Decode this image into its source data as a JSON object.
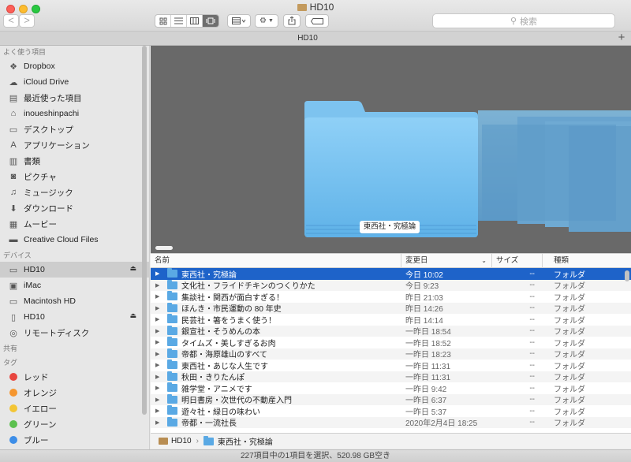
{
  "window": {
    "title": "HD10"
  },
  "toolbar": {
    "back_label": "<",
    "forward_label": ">",
    "action_menu": "⚙",
    "search_placeholder": "検索"
  },
  "tabbar": {
    "tab_label": "HD10",
    "add_label": "+"
  },
  "sidebar": {
    "favorites_title": "よく使う項目",
    "favorites": [
      {
        "label": "Dropbox",
        "icon": "dropbox-icon"
      },
      {
        "label": "iCloud Drive",
        "icon": "cloud-icon"
      },
      {
        "label": "最近使った項目",
        "icon": "recent-icon"
      },
      {
        "label": "inoueshinpachi",
        "icon": "home-icon"
      },
      {
        "label": "デスクトップ",
        "icon": "desktop-icon"
      },
      {
        "label": "アプリケーション",
        "icon": "applications-icon"
      },
      {
        "label": "書類",
        "icon": "documents-icon"
      },
      {
        "label": "ピクチャ",
        "icon": "camera-icon"
      },
      {
        "label": "ミュージック",
        "icon": "music-icon"
      },
      {
        "label": "ダウンロード",
        "icon": "download-icon"
      },
      {
        "label": "ムービー",
        "icon": "movie-icon"
      },
      {
        "label": "Creative Cloud Files",
        "icon": "folder-icon"
      }
    ],
    "devices_title": "デバイス",
    "devices": [
      {
        "label": "HD10",
        "icon": "disk-icon",
        "eject": true
      },
      {
        "label": "iMac",
        "icon": "imac-icon",
        "eject": false
      },
      {
        "label": "Macintosh HD",
        "icon": "disk-icon",
        "eject": false
      },
      {
        "label": "HD10",
        "icon": "disk-icon",
        "eject": true
      },
      {
        "label": "リモートディスク",
        "icon": "remote-disc-icon",
        "eject": false
      }
    ],
    "shared_title": "共有",
    "tags_title": "タグ",
    "tags": [
      {
        "label": "レッド",
        "color": "#e8463f"
      },
      {
        "label": "オレンジ",
        "color": "#f5962f"
      },
      {
        "label": "イエロー",
        "color": "#f3c534"
      },
      {
        "label": "グリーン",
        "color": "#5bc04e"
      },
      {
        "label": "ブルー",
        "color": "#3d8ee8"
      }
    ]
  },
  "coverflow": {
    "selected_label": "東西社・究極論"
  },
  "list": {
    "headers": {
      "name": "名前",
      "date": "変更日",
      "size": "サイズ",
      "kind": "種類"
    },
    "rows": [
      {
        "name": "東西社・究極論",
        "date": "今日 10:02",
        "size": "--",
        "kind": "フォルダ"
      },
      {
        "name": "文化社・フライドチキンのつくりかた",
        "date": "今日 9:23",
        "size": "--",
        "kind": "フォルダ"
      },
      {
        "name": "集談社・関西が面白すぎる！",
        "date": "昨日 21:03",
        "size": "--",
        "kind": "フォルダ"
      },
      {
        "name": "ほんき・市民運動の 80 年史",
        "date": "昨日 14:26",
        "size": "--",
        "kind": "フォルダ"
      },
      {
        "name": "民芸社・箸をうまく使う！",
        "date": "昨日 14:14",
        "size": "--",
        "kind": "フォルダ"
      },
      {
        "name": "銀宣社・そうめんの本",
        "date": "一昨日 18:54",
        "size": "--",
        "kind": "フォルダ"
      },
      {
        "name": "タイムズ・美しすぎるお肉",
        "date": "一昨日 18:52",
        "size": "--",
        "kind": "フォルダ"
      },
      {
        "name": "帝都・海原雄山のすべて",
        "date": "一昨日 18:23",
        "size": "--",
        "kind": "フォルダ"
      },
      {
        "name": "東西社・あじな人生です",
        "date": "一昨日 11:31",
        "size": "--",
        "kind": "フォルダ"
      },
      {
        "name": "秋田・きりたんぽ",
        "date": "一昨日 11:31",
        "size": "--",
        "kind": "フォルダ"
      },
      {
        "name": "雑学堂・アニメです",
        "date": "一昨日 9:42",
        "size": "--",
        "kind": "フォルダ"
      },
      {
        "name": "明日書房・次世代の不動産入門",
        "date": "一昨日 6:37",
        "size": "--",
        "kind": "フォルダ"
      },
      {
        "name": "遊々社・緑日の味わい",
        "date": "一昨日 5:37",
        "size": "--",
        "kind": "フォルダ"
      },
      {
        "name": "帝都・一流社長",
        "date": "2020年2月4日 18:25",
        "size": "--",
        "kind": "フォルダ"
      }
    ]
  },
  "pathbar": {
    "disk": "HD10",
    "sep": "›",
    "folder": "東西社・究極論"
  },
  "status": {
    "text": "227項目中の1項目を選択、520.98 GB空き"
  }
}
